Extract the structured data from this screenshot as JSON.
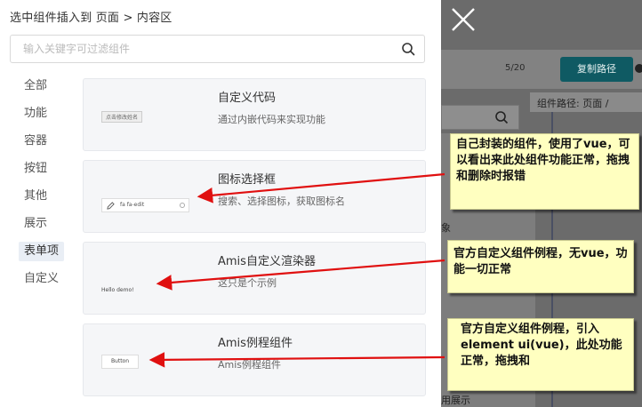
{
  "drawer": {
    "title": "选中组件插入到 页面 > 内容区",
    "search_placeholder": "输入关键字可过滤组件"
  },
  "categories": [
    {
      "label": "全部",
      "active": false
    },
    {
      "label": "功能",
      "active": false
    },
    {
      "label": "容器",
      "active": false
    },
    {
      "label": "按钮",
      "active": false
    },
    {
      "label": "其他",
      "active": false
    },
    {
      "label": "展示",
      "active": false
    },
    {
      "label": "表单项",
      "active": true
    },
    {
      "label": "自定义",
      "active": false
    }
  ],
  "components": [
    {
      "title": "自定义代码",
      "description": "通过内嵌代码来实现功能",
      "preview": "点击修改姓名"
    },
    {
      "title": "图标选择框",
      "description": "搜索、选择图标，获取图标名",
      "preview": "fa fa-edit"
    },
    {
      "title": "Amis自定义渲染器",
      "description": "这只是个示例",
      "preview": "Hello demo!"
    },
    {
      "title": "Amis例程组件",
      "description": "Amis例程组件",
      "preview": "Button"
    }
  ],
  "background": {
    "counter": "5/20",
    "copy_button": "复制路径",
    "path": "组件路径:  页面  /",
    "fragment_xiang": "象",
    "fragment_zhanshi": "用展示"
  },
  "annotations": [
    "自己封装的组件，使用了vue，可以看出来此处组件功能正常，拖拽和删除时报错",
    "官方自定义组件例程，无vue，功能一切正常",
    "官方自定义组件例程，引入element ui(vue)，此处功能正常，拖拽和"
  ],
  "colors": {
    "annotation_bg": "#ffffc0",
    "arrow": "#e01010",
    "overlay": "#6b6b6b",
    "copy_button_bg": "#0f5a63",
    "active_category_bg": "#e9eef5"
  },
  "icons": [
    "search-icon",
    "close-icon",
    "pencil-icon",
    "info-icon"
  ]
}
